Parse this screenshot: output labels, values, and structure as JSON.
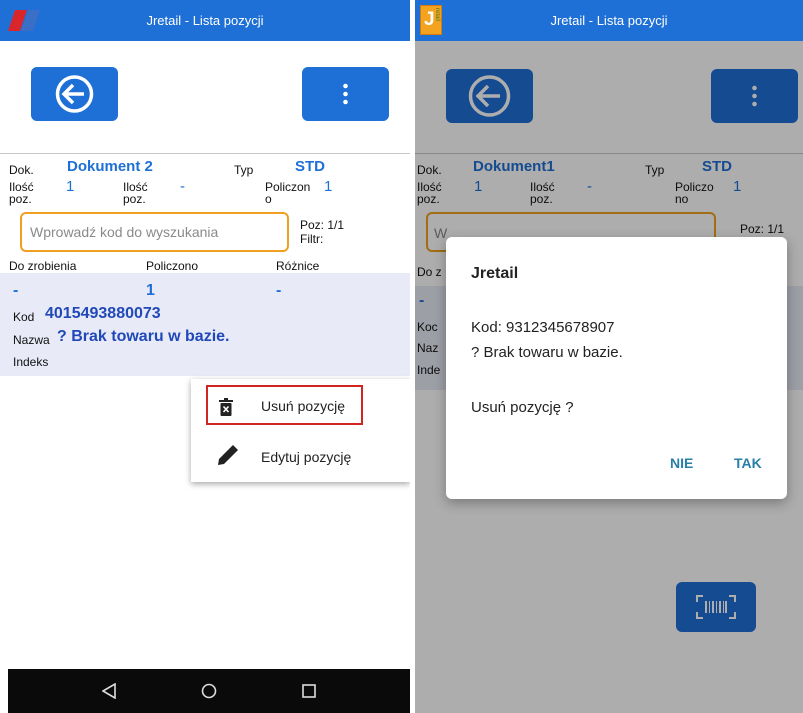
{
  "left": {
    "title": "Jretail - Lista pozycji",
    "labels": {
      "dok": "Dok.",
      "typ": "Typ",
      "ilosc1_a": "Ilość",
      "ilosc1_b": "poz.",
      "ilosc2_a": "Ilość",
      "ilosc2_b": "poz.",
      "policzono_a": "Policzon",
      "policzono_b": "o",
      "poz": "Poz: 1/1",
      "filtr": "Filtr:",
      "do_zrobienia": "Do zrobienia",
      "policzono": "Policzono",
      "roznice": "Różnice",
      "kod": "Kod",
      "nazwa": "Nazwa",
      "indeks": "Indeks"
    },
    "values": {
      "dokument": "Dokument 2",
      "typ": "STD",
      "ilosc1": "1",
      "ilosc2": "-",
      "policzono": "1"
    },
    "search_placeholder": "Wprowadź kod do wyszukania",
    "row": {
      "do_zrobienia": "-",
      "policzono": "1",
      "roznice": "-",
      "kod": "4015493880073",
      "nazwa": "? Brak towaru w bazie."
    },
    "menu": {
      "delete": "Usuń pozycję",
      "edit": "Edytuj pozycję"
    }
  },
  "right": {
    "title": "Jretail - Lista pozycji",
    "logo_letter": "J",
    "logo_small": "retail",
    "labels": {
      "dok": "Dok.",
      "typ": "Typ",
      "ilosc1_a": "Ilość",
      "ilosc1_b": "poz.",
      "ilosc2_a": "Ilość",
      "ilosc2_b": "poz.",
      "policzono_a": "Policzo",
      "policzono_b": "no",
      "poz": "Poz: 1/1",
      "do_fragment": "Do z",
      "kod_fragment": "Koc",
      "nazwa_fragment": "Naz",
      "indeks_fragment": "Inde",
      "search_fragment": "W",
      "dash_fragment": "-"
    },
    "values": {
      "dokument": "Dokument1",
      "typ": "STD",
      "ilosc1": "1",
      "ilosc2": "-",
      "policzono": "1"
    },
    "dialog": {
      "title": "Jretail",
      "kod_line": "Kod: 9312345678907",
      "name_line": "? Brak towaru w bazie.",
      "question": "Usuń pozycję ?",
      "no": "NIE",
      "yes": "TAK"
    }
  },
  "colors": {
    "primary": "#1e6fd6",
    "search_border": "#f0a020",
    "highlight_red": "#d32424",
    "dialog_button": "#2a7fa8"
  }
}
